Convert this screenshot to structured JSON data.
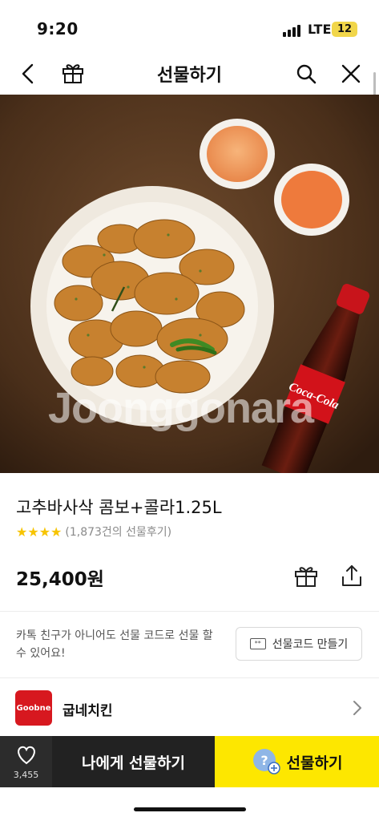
{
  "status_bar": {
    "time": "9:20",
    "network": "LTE",
    "battery": "12"
  },
  "nav": {
    "title": "선물하기"
  },
  "hero": {
    "watermark": "Joonggonara",
    "bottle_label": "Coca-Cola"
  },
  "product": {
    "name": "고추바사삭 콤보+콜라1.25L",
    "stars": "★★★★",
    "review_count": "(1,873건의 선물후기)",
    "price": "25,400원"
  },
  "gift_code": {
    "description": "카톡 친구가 아니어도 선물 코드로 선물 할 수 있어요!",
    "button_label": "선물코드 만들기"
  },
  "brand": {
    "logo_text": "Goobne",
    "name": "굽네치킨"
  },
  "bottom_bar": {
    "like_count": "3,455",
    "gift_self_label": "나에게 선물하기",
    "gift_label": "선물하기"
  },
  "colors": {
    "accent": "#fde700",
    "dark": "#222222",
    "star": "#f7c400",
    "brand": "#d7181f"
  }
}
